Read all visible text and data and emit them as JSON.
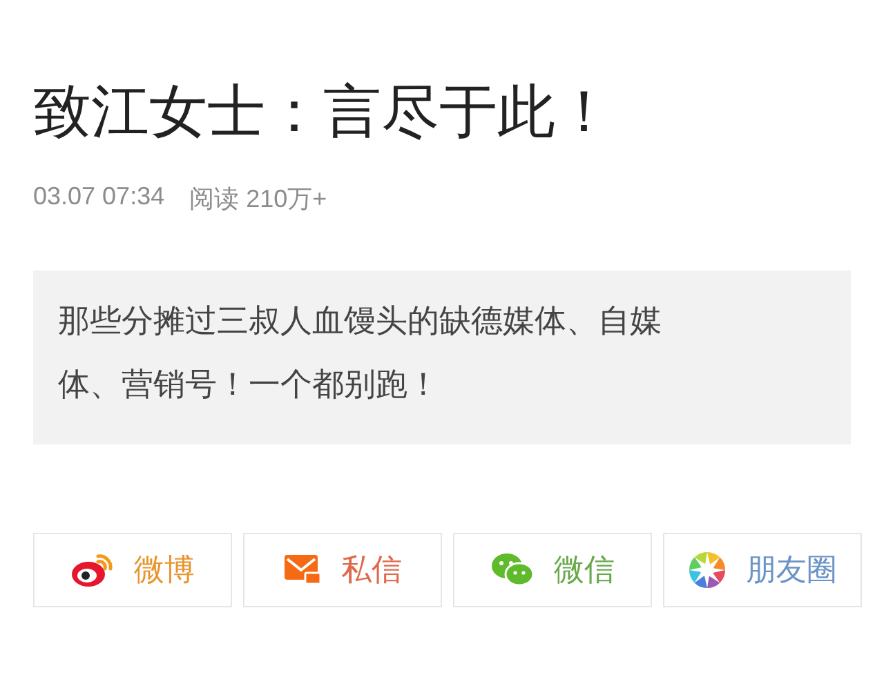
{
  "article": {
    "title": "致江女士：言尽于此！",
    "date": "03.07 07:34",
    "reads": "阅读 210万+",
    "summary": "那些分摊过三叔人血馒头的缺德媒体、自媒体、营销号！一个都别跑！"
  },
  "share_buttons": [
    {
      "kind": "weibo",
      "label": "微博",
      "color": "#e8952e"
    },
    {
      "kind": "message",
      "label": "私信",
      "color": "#e0684a"
    },
    {
      "kind": "wechat",
      "label": "微信",
      "color": "#68a84a"
    },
    {
      "kind": "moments",
      "label": "朋友圈",
      "color": "#6b93c6"
    }
  ]
}
